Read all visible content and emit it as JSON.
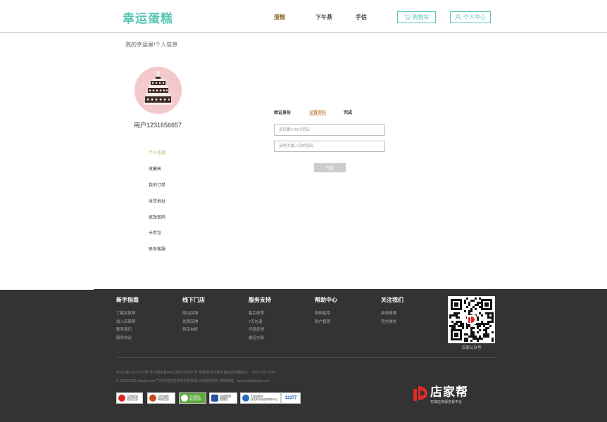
{
  "header": {
    "logo": "幸运蛋糕",
    "nav": [
      "蛋糕",
      "下午茶",
      "手信"
    ],
    "cart_label": "购物车",
    "user_center_label": "个人中心"
  },
  "breadcrumb": "我的幸运屋/个人信息",
  "profile": {
    "username": "用户1231656657"
  },
  "side_menu": [
    "个人信息",
    "收藏夹",
    "我的订单",
    "收货地址",
    "修改密码",
    "卡劵包",
    "联系客服"
  ],
  "steps": [
    "验证身份",
    "设置密码",
    "完成"
  ],
  "form": {
    "password_placeholder": "请设置6-20位密码",
    "confirm_placeholder": "请再次输入您的密码",
    "submit_label": "完成"
  },
  "footer": {
    "columns": [
      {
        "title": "新手指南",
        "links": [
          "了解店家帮",
          "加入店家帮",
          "联系我们",
          "服务协议"
        ]
      },
      {
        "title": "线下门店",
        "links": [
          "周边店铺",
          "优质店铺",
          "到店自提"
        ]
      },
      {
        "title": "服务支持",
        "links": [
          "售后政策",
          "7天包退",
          "问题反馈",
          "最佳交易"
        ]
      },
      {
        "title": "帮助中心",
        "links": [
          "购物指南",
          "账户管理"
        ]
      },
      {
        "title": "关注我们",
        "links": [
          "新浪微博",
          "官方微信"
        ]
      }
    ],
    "qr_label": "店家公众号",
    "icp": "粤ICP备16017572号    粤公网安备44010602000169号    互联网违法和不良信息举报中心：4000-003-9334",
    "copyright": "© 2011-2016 dianjia.com广州市时店家信息科技有限公司版权所有 举报邮箱：service@dianjia.com",
    "badges": [
      {
        "line1": "可信网站",
        "line2": "验证信息"
      },
      {
        "line1": "可信诚性",
        "line2": "网站信息"
      },
      {
        "line1": "360网站",
        "line2": "安全检测"
      },
      {
        "line1": "网络警察",
        "line2": "提醒您"
      },
      {
        "line1": "中国互联网",
        "line2": "违法和不良信息举报中心"
      },
      {
        "line1": "12377",
        "line2": ""
      }
    ],
    "brand_name": "店家帮",
    "brand_tagline": "实体店资源交易平台"
  },
  "colors": {
    "brand_teal": "#58c6b2",
    "accent_gold": "#c49a5a",
    "footer_bg": "#333333"
  }
}
